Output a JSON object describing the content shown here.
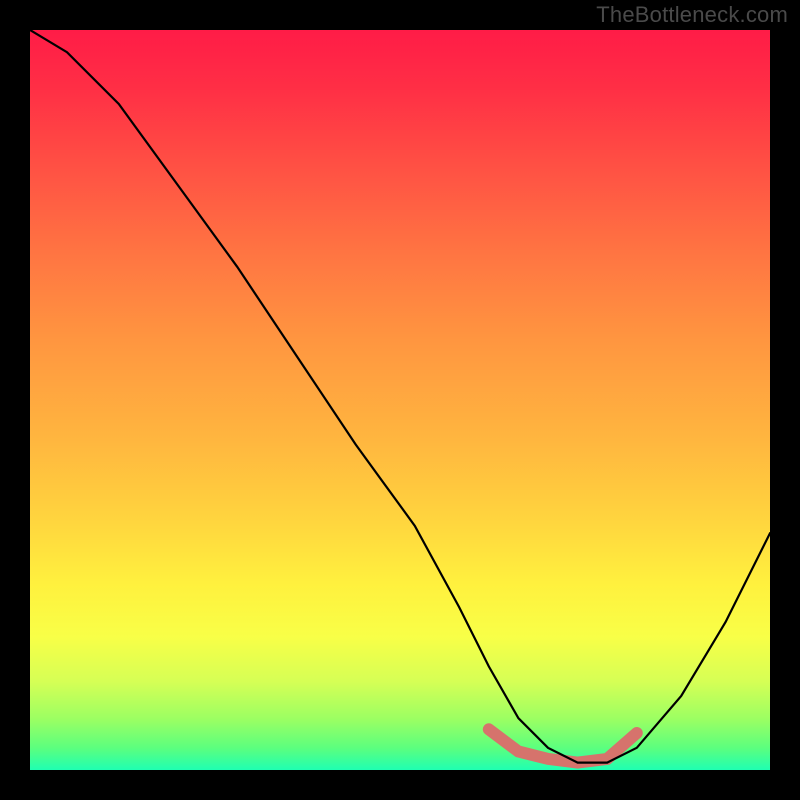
{
  "watermark": "TheBottleneck.com",
  "colors": {
    "background": "#000000",
    "gradient_top": "#ff1c47",
    "gradient_bottom": "#1fffb2",
    "curve": "#000000",
    "highlight": "#d6736c",
    "watermark_text": "#4a4a4a"
  },
  "chart_data": {
    "type": "line",
    "title": "",
    "xlabel": "",
    "ylabel": "",
    "xlim": [
      0,
      100
    ],
    "ylim": [
      0,
      100
    ],
    "grid": false,
    "series": [
      {
        "name": "bottleneck-curve",
        "x": [
          0,
          5,
          12,
          20,
          28,
          36,
          44,
          52,
          58,
          62,
          66,
          70,
          74,
          78,
          82,
          88,
          94,
          100
        ],
        "values": [
          100,
          97,
          90,
          79,
          68,
          56,
          44,
          33,
          22,
          14,
          7,
          3,
          1,
          1,
          3,
          10,
          20,
          32
        ]
      }
    ],
    "annotations": [
      {
        "name": "sweet-spot-highlight",
        "type": "line-segment",
        "x": [
          62,
          66,
          70,
          74,
          78,
          82
        ],
        "values": [
          5.5,
          2.5,
          1.5,
          1.0,
          1.5,
          5.0
        ]
      }
    ]
  }
}
